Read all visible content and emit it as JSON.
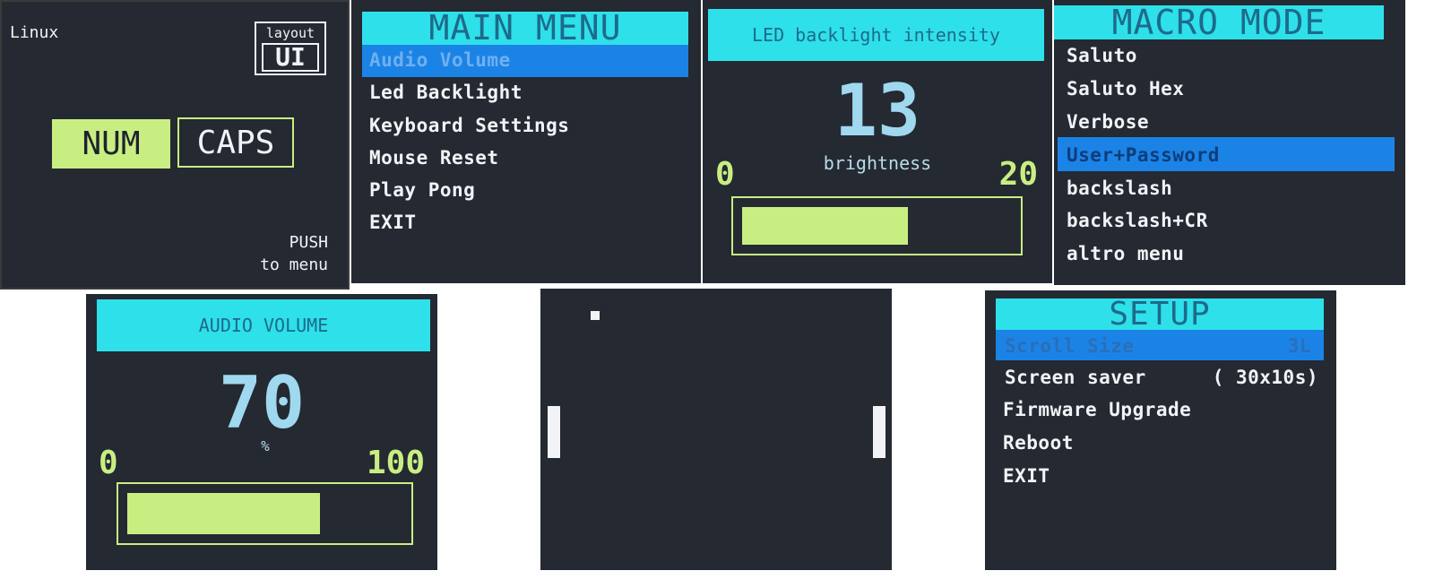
{
  "screen_home": {
    "os_label": "Linux",
    "layout_label": "layout",
    "layout_value": "UI",
    "num_label": "NUM",
    "caps_label": "CAPS",
    "push_line1": "PUSH",
    "push_line2": "to menu"
  },
  "screen_main_menu": {
    "title": "MAIN MENU",
    "items": [
      "Audio Volume",
      "Led Backlight",
      "Keyboard Settings",
      "Mouse Reset",
      "Play Pong",
      "EXIT"
    ],
    "selected_index": 0
  },
  "screen_led": {
    "title": "LED backlight intensity",
    "value": "13",
    "unit_label": "brightness",
    "min_label": "0",
    "max_label": "20",
    "level_fraction": 0.65
  },
  "screen_macro": {
    "title": "MACRO MODE",
    "items": [
      "Saluto",
      "Saluto Hex",
      "Verbose",
      "User+Password",
      "backslash",
      "backslash+CR",
      "altro menu"
    ],
    "selected_index": 3
  },
  "screen_audio": {
    "title": "AUDIO VOLUME",
    "value": "70",
    "unit_label": "%",
    "min_label": "0",
    "max_label": "100",
    "level_fraction": 0.7
  },
  "screen_pong": {},
  "screen_setup": {
    "title": "SETUP",
    "items": [
      {
        "label": "Scroll Size",
        "value": "3L"
      },
      {
        "label": "Screen saver",
        "value": "( 30x10s)"
      },
      {
        "label": "Firmware Upgrade",
        "value": ""
      },
      {
        "label": "Reboot",
        "value": ""
      },
      {
        "label": "EXIT",
        "value": ""
      }
    ],
    "selected_index": 0
  },
  "colors": {
    "screen_bg": "#242932",
    "header_cyan": "#2ee0ea",
    "selection_blue": "#1c83e6",
    "lime": "#c8ee82",
    "text": "#f1f3f6"
  }
}
